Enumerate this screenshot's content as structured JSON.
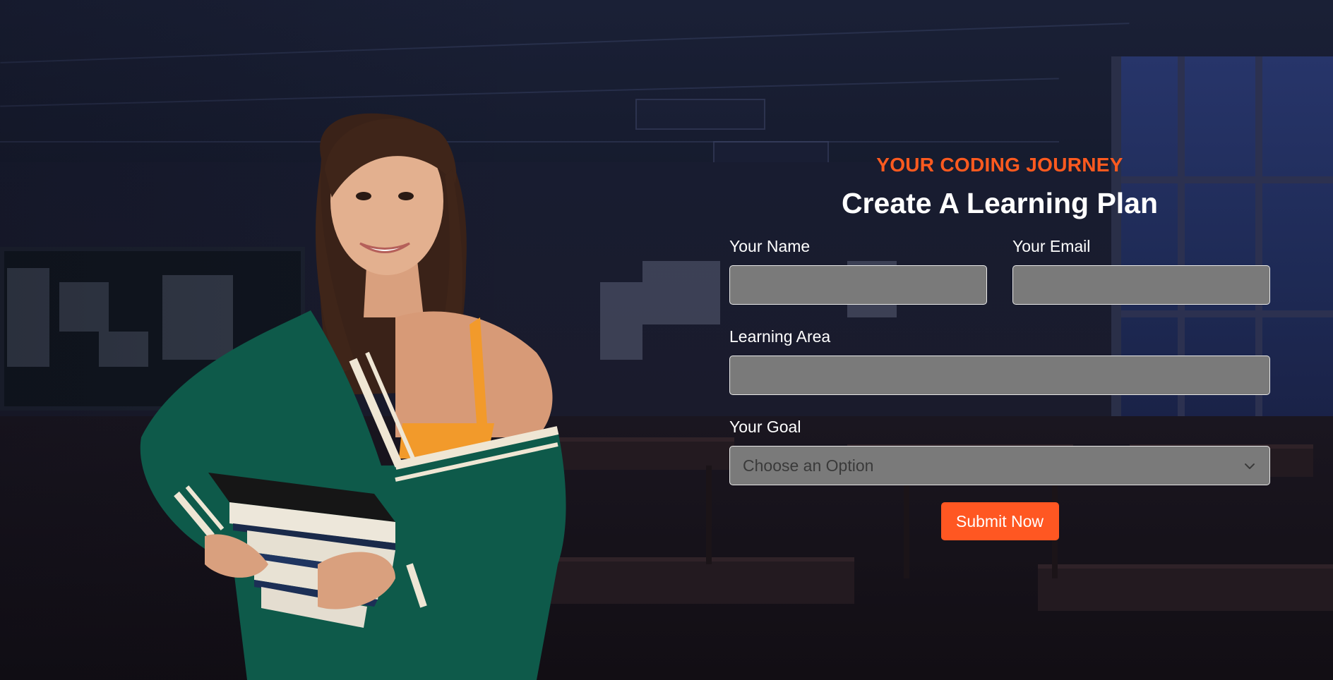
{
  "hero": {
    "eyebrow": "YOUR CODING JOURNEY",
    "title": "Create A Learning Plan"
  },
  "form": {
    "name_label": "Your Name",
    "name_value": "",
    "email_label": "Your Email",
    "email_value": "",
    "area_label": "Learning Area",
    "area_value": "",
    "goal_label": "Your Goal",
    "goal_selected": "Choose an Option",
    "submit_label": "Submit Now"
  },
  "colors": {
    "accent": "#ff5722",
    "eyebrow": "#ff5a1f",
    "input_bg": "#7a7a7a",
    "text": "#ffffff"
  },
  "icons": {
    "goal_dropdown": "chevron-down-icon"
  }
}
